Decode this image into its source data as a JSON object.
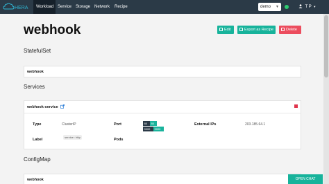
{
  "navbar": {
    "logo_text": "HERA",
    "items": [
      {
        "label": "Workload"
      },
      {
        "label": "Service"
      },
      {
        "label": "Storage"
      },
      {
        "label": "Network"
      },
      {
        "label": "Recipe"
      }
    ],
    "namespace": "demo",
    "user": "T P"
  },
  "page": {
    "title": "webhook",
    "buttons": {
      "edit": "Edit",
      "export": "Export as Recipe",
      "delete": "Delete"
    }
  },
  "statefulset": {
    "title": "StatefulSet",
    "name": "webhook"
  },
  "services": {
    "title": "Services",
    "name": "webhook-service",
    "type_label": "Type",
    "type_value": "ClusterIP",
    "port_label": "Port",
    "ports": [
      {
        "port": "80",
        "target": "80"
      },
      {
        "port": "9000",
        "target": "9000"
      }
    ],
    "external_ips_label": "External IPs",
    "external_ips_value": "203.185.64.1",
    "label_label": "Label",
    "label_value": "service : http",
    "pods_label": "Pods"
  },
  "configmap": {
    "title": "ConfigMap",
    "name": "webhook"
  },
  "chat": {
    "label": "OPEN CHAT"
  },
  "colors": {
    "navbar": "#2b3a47",
    "accent": "#17b39b",
    "danger": "#ec4d5e",
    "status": "#2ecc71"
  }
}
